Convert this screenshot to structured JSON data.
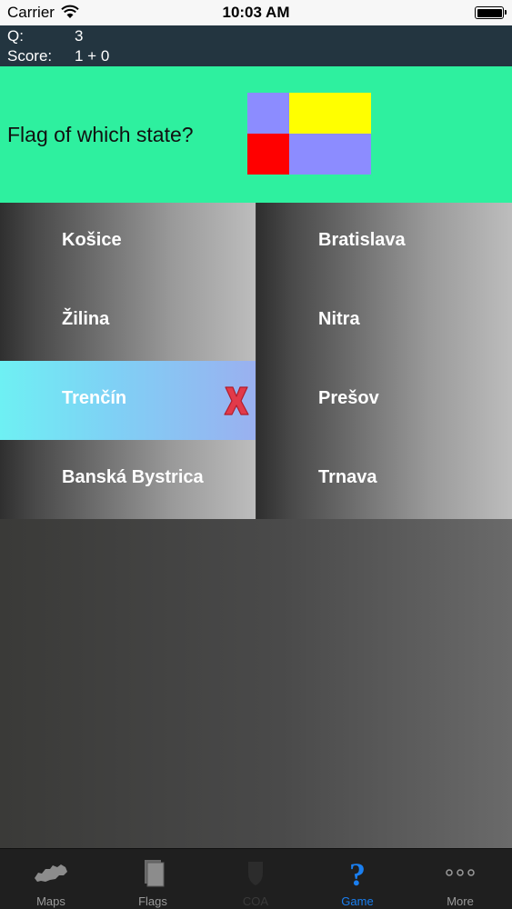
{
  "status_bar": {
    "carrier": "Carrier",
    "time": "10:03 AM"
  },
  "score": {
    "q_label": "Q:",
    "q_value": "3",
    "score_label": "Score:",
    "score_value": "1 + 0"
  },
  "question": {
    "text": "Flag of which state?",
    "flag_colors": {
      "top_left": "#8c8cff",
      "top_right": "#ffff00",
      "bottom_left": "#ff0000",
      "bottom_right": "#8c8cff"
    }
  },
  "answers": [
    {
      "label": "Košice",
      "state": "normal"
    },
    {
      "label": "Bratislava",
      "state": "normal"
    },
    {
      "label": "Žilina",
      "state": "normal"
    },
    {
      "label": "Nitra",
      "state": "correct",
      "mark_icon": "checkmark-icon"
    },
    {
      "label": "Trenčín",
      "state": "wrong",
      "mark_icon": "x-mark-icon"
    },
    {
      "label": "Prešov",
      "state": "normal"
    },
    {
      "label": "Banská Bystrica",
      "state": "normal"
    },
    {
      "label": "Trnava",
      "state": "normal"
    }
  ],
  "tab_bar": {
    "tabs": [
      {
        "label": "Maps",
        "icon": "slovakia-map-icon",
        "state": "normal"
      },
      {
        "label": "Flags",
        "icon": "flags-icon",
        "state": "normal"
      },
      {
        "label": "COA",
        "icon": "coa-icon",
        "state": "disabled"
      },
      {
        "label": "Game",
        "icon": "question-mark-icon",
        "state": "selected"
      },
      {
        "label": "More",
        "icon": "more-icon",
        "state": "normal"
      }
    ],
    "colors": {
      "selected": "#1a7ff0",
      "normal": "#9a9a9a",
      "disabled": "#3a3a3a"
    }
  }
}
